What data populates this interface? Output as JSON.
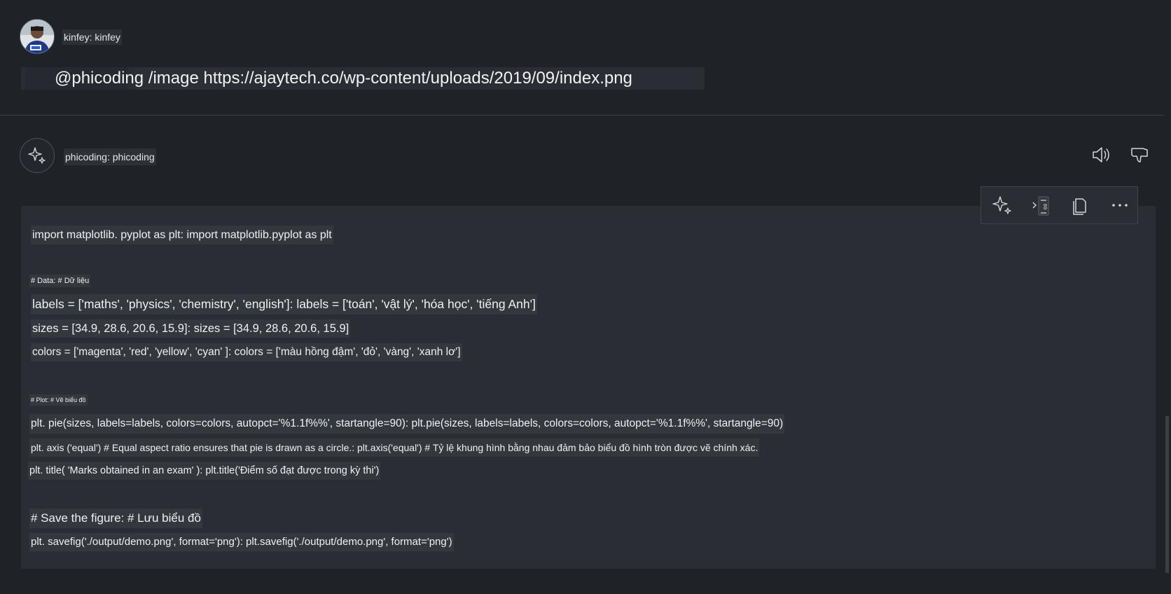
{
  "user": {
    "name": "kinfey: kinfey",
    "prompt": "@phicoding /image https://ajaytech.co/wp-content/uploads/2019/09/index.png"
  },
  "bot": {
    "name": "phicoding: phicoding"
  },
  "code": {
    "lines": [
      "import matplotlib. pyplot as plt: import matplotlib.pyplot as plt",
      "# Data: # Dữ liệu",
      "labels = ['maths', 'physics', 'chemistry', 'english']: labels = ['toán', 'vật lý', 'hóa học', 'tiếng Anh']",
      "sizes = [34.9, 28.6, 20.6, 15.9]: sizes = [34.9, 28.6, 20.6, 15.9]",
      "colors = ['magenta', 'red', 'yellow', 'cyan' ]: colors = ['màu hồng đậm', 'đỏ', 'vàng', 'xanh lơ']",
      "# Plot: # Vẽ biểu đồ",
      "plt. pie(sizes, labels=labels, colors=colors, autopct='%1.1f%%', startangle=90): plt.pie(sizes, labels=labels, colors=colors, autopct='%1.1f%%', startangle=90)",
      "plt. axis ('equal') # Equal aspect ratio ensures that pie is drawn as a circle.: plt.axis('equal') # Tỷ lệ khung hình bằng nhau đảm bảo biểu đồ hình tròn được vẽ chính xác.",
      "plt. title( 'Marks obtained in an exam' ): plt.title('Điểm số đạt được trong kỳ thi')",
      "# Save the figure: # Lưu biểu đồ",
      "plt. savefig('./output/demo.png', format='png'): plt.savefig('./output/demo.png', format='png')"
    ]
  },
  "icons": {
    "bot_avatar": "sparkle-icon",
    "read_aloud": "speaker-icon",
    "dislike": "thumbs-down-icon",
    "apply": "sparkle-icon",
    "insert": "insert-at-cursor-icon",
    "copy": "copy-icon",
    "more": "more-icon"
  },
  "colors": {
    "background": "#1f2328",
    "panel": "#2a2e34",
    "text": "#f0f0f0"
  }
}
